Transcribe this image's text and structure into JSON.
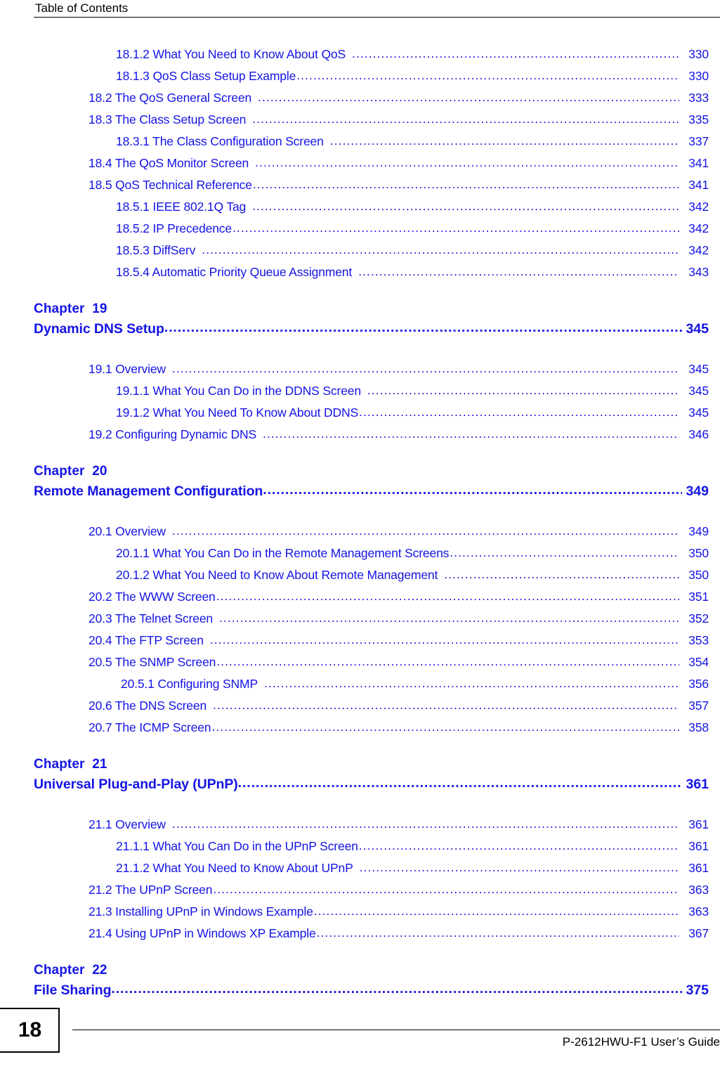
{
  "header": {
    "title": "Table of Contents"
  },
  "toc": {
    "blocks": [
      {
        "kind": "entries",
        "entries": [
          {
            "level": 3,
            "label": "18.1.2 What You Need to Know About QoS",
            "page": "330",
            "gap": true
          },
          {
            "level": 3,
            "label": "18.1.3 QoS Class Setup Example",
            "page": "330",
            "gap": false
          },
          {
            "level": 2,
            "label": "18.2 The QoS General Screen",
            "page": "333",
            "gap": true
          },
          {
            "level": 2,
            "label": "18.3 The Class Setup Screen",
            "page": "335",
            "gap": true
          },
          {
            "level": 3,
            "label": "18.3.1 The Class Configuration Screen",
            "page": "337",
            "gap": true
          },
          {
            "level": 2,
            "label": "18.4 The QoS Monitor Screen",
            "page": "341",
            "gap": true
          },
          {
            "level": 2,
            "label": "18.5 QoS Technical Reference",
            "page": "341",
            "gap": false
          },
          {
            "level": 3,
            "label": "18.5.1 IEEE 802.1Q Tag",
            "page": "342",
            "gap": true
          },
          {
            "level": 3,
            "label": "18.5.2 IP Precedence",
            "page": "342",
            "gap": false
          },
          {
            "level": 3,
            "label": "18.5.3 DiffServ",
            "page": "342",
            "gap": true
          },
          {
            "level": 3,
            "label": "18.5.4 Automatic Priority Queue Assignment",
            "page": "343",
            "gap": true
          }
        ]
      },
      {
        "kind": "chapter",
        "chapter_number": "Chapter  19",
        "chapter_title": "Dynamic DNS Setup",
        "chapter_page": "345"
      },
      {
        "kind": "entries",
        "entries": [
          {
            "level": 2,
            "label": "19.1 Overview",
            "page": "345",
            "gap": true
          },
          {
            "level": 3,
            "label": "19.1.1 What You Can Do in the DDNS Screen",
            "page": "345",
            "gap": true
          },
          {
            "level": 3,
            "label": "19.1.2 What You Need To Know About DDNS",
            "page": "345",
            "gap": false
          },
          {
            "level": 2,
            "label": "19.2 Configuring Dynamic DNS",
            "page": "346",
            "gap": true
          }
        ]
      },
      {
        "kind": "chapter",
        "chapter_number": "Chapter  20",
        "chapter_title": "Remote Management Configuration",
        "chapter_page": "349"
      },
      {
        "kind": "entries",
        "entries": [
          {
            "level": 2,
            "label": "20.1 Overview",
            "page": "349",
            "gap": true
          },
          {
            "level": 3,
            "label": "20.1.1 What You Can Do in the Remote Management Screens",
            "page": "350",
            "gap": false
          },
          {
            "level": 3,
            "label": "20.1.2 What You Need to Know About Remote Management",
            "page": "350",
            "gap": true
          },
          {
            "level": 2,
            "label": "20.2 The WWW Screen",
            "page": "351",
            "gap": false
          },
          {
            "level": 2,
            "label": "20.3 The Telnet Screen",
            "page": "352",
            "gap": true
          },
          {
            "level": 2,
            "label": "20.4 The FTP Screen",
            "page": "353",
            "gap": true
          },
          {
            "level": 2,
            "label": "20.5 The SNMP Screen",
            "page": "354",
            "gap": false
          },
          {
            "level": 4,
            "label": "20.5.1 Configuring SNMP",
            "page": "356",
            "gap": true
          },
          {
            "level": 2,
            "label": "20.6 The DNS Screen",
            "page": "357",
            "gap": true
          },
          {
            "level": 2,
            "label": "20.7 The ICMP Screen",
            "page": "358",
            "gap": false
          }
        ]
      },
      {
        "kind": "chapter",
        "chapter_number": "Chapter  21",
        "chapter_title": "Universal Plug-and-Play (UPnP)",
        "chapter_page": "361"
      },
      {
        "kind": "entries",
        "entries": [
          {
            "level": 2,
            "label": "21.1 Overview",
            "page": "361",
            "gap": true
          },
          {
            "level": 3,
            "label": "21.1.1 What You Can Do in the UPnP Screen",
            "page": "361",
            "gap": false
          },
          {
            "level": 3,
            "label": "21.1.2 What You Need to Know About UPnP",
            "page": "361",
            "gap": true
          },
          {
            "level": 2,
            "label": "21.2 The UPnP Screen",
            "page": "363",
            "gap": false
          },
          {
            "level": 2,
            "label": "21.3 Installing UPnP in Windows Example",
            "page": "363",
            "gap": false
          },
          {
            "level": 2,
            "label": "21.4 Using UPnP in Windows XP Example",
            "page": "367",
            "gap": false
          }
        ]
      },
      {
        "kind": "chapter",
        "chapter_number": "Chapter  22",
        "chapter_title": "File Sharing",
        "chapter_page": "375"
      }
    ]
  },
  "footer": {
    "page_number": "18",
    "guide_text": "P-2612HWU-F1 User’s Guide"
  },
  "colors": {
    "link_blue": "#1414e6",
    "text_black": "#000000",
    "background": "#ffffff"
  }
}
